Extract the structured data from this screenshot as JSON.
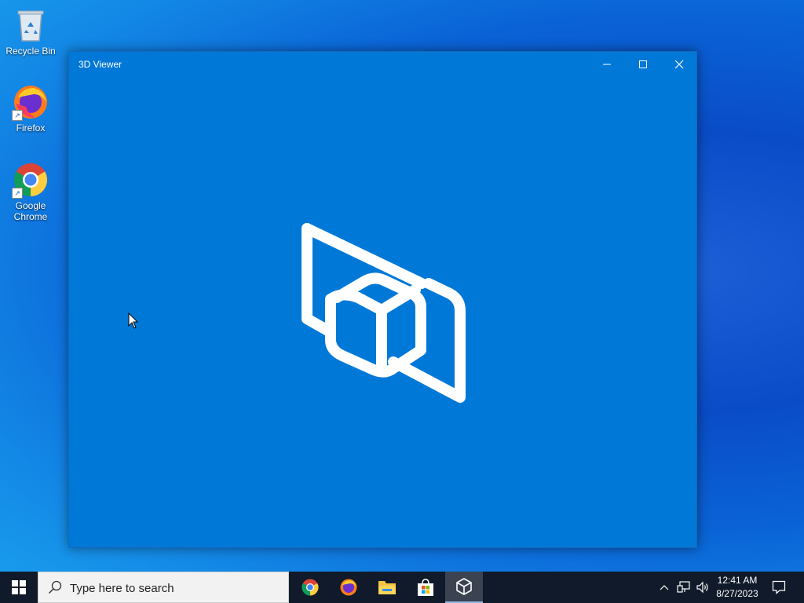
{
  "desktop": {
    "icons": [
      {
        "label": "Recycle Bin",
        "icon": "recycle-bin-icon"
      },
      {
        "label": "Firefox",
        "icon": "firefox-icon"
      },
      {
        "label": "Google Chrome",
        "icon": "chrome-icon"
      }
    ]
  },
  "window": {
    "title": "3D Viewer",
    "background": "#0078d7",
    "controls": [
      "minimize-icon",
      "maximize-icon",
      "close-icon"
    ],
    "splash_icon": "3d-viewer-logo-icon"
  },
  "taskbar": {
    "start_icon": "windows-logo-icon",
    "search_placeholder": "Type here to search",
    "pinned": [
      "chrome-icon",
      "firefox-icon",
      "file-explorer-icon",
      "microsoft-store-icon",
      "3d-viewer-icon"
    ],
    "active_app": "3d-viewer-icon",
    "tray_icons": [
      "chevron-up-icon",
      "network-icon",
      "volume-icon"
    ],
    "time": "12:41 AM",
    "date": "8/27/2023",
    "notification_icon": "action-center-icon"
  }
}
